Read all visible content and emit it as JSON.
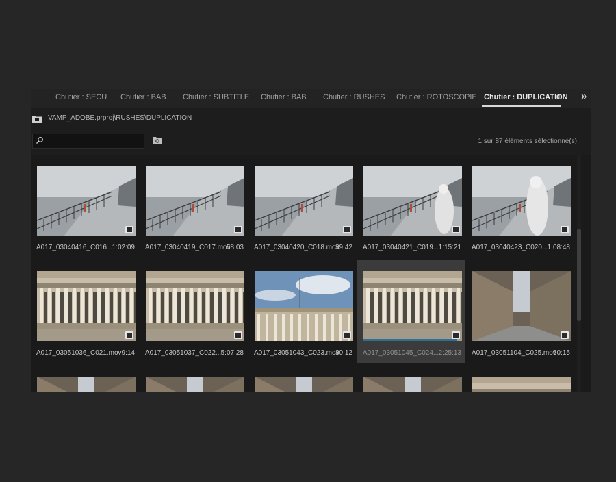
{
  "tabs": [
    {
      "label": "Chutier : SECU",
      "active": false
    },
    {
      "label": "Chutier : BAB",
      "active": false
    },
    {
      "label": "Chutier : SUBTITLE",
      "active": false
    },
    {
      "label": "Chutier : BAB",
      "active": false
    },
    {
      "label": "Chutier : RUSHES",
      "active": false
    },
    {
      "label": "Chutier : ROTOSCOPIE",
      "active": false
    },
    {
      "label": "Chutier : DUPLICATION",
      "active": true
    }
  ],
  "tab_menu_icon": "hamburger-menu-icon",
  "overflow_icon": "double-chevron-right-icon",
  "path": "VAMP_ADOBE.prproj\\RUSHES\\DUPLICATION",
  "search": {
    "value": "",
    "placeholder": ""
  },
  "selection_count": "1 sur 87 éléments sélectionné(s)",
  "clips": [
    {
      "name": "A017_03040416_C016....",
      "duration": "1:02:09",
      "scene": "quay",
      "selected": false
    },
    {
      "name": "A017_03040419_C017.mov",
      "duration": "58:03",
      "scene": "quay",
      "selected": false
    },
    {
      "name": "A017_03040420_C018.mov",
      "duration": "39:42",
      "scene": "quay",
      "selected": false
    },
    {
      "name": "A017_03040421_C019....",
      "duration": "1:15:21",
      "scene": "quay-person",
      "selected": false
    },
    {
      "name": "A017_03040423_C020....",
      "duration": "1:08:48",
      "scene": "quay-person-close",
      "selected": false
    },
    {
      "name": "A017_03051036_C021.mov",
      "duration": "9:14",
      "scene": "colonnade",
      "selected": false
    },
    {
      "name": "A017_03051037_C022....",
      "duration": "5:07:28",
      "scene": "colonnade",
      "selected": false
    },
    {
      "name": "A017_03051043_C023.mov",
      "duration": "30:12",
      "scene": "sky-building",
      "selected": false
    },
    {
      "name": "A017_03051045_C024....",
      "duration": "2:25:13",
      "scene": "colonnade",
      "selected": true,
      "progress": 0.95
    },
    {
      "name": "A017_03051104_C025.mov",
      "duration": "50:15",
      "scene": "street",
      "selected": false
    }
  ],
  "colors": {
    "accent": "#2f6f94",
    "background": "#262626",
    "panel": "#1d1d1d"
  }
}
